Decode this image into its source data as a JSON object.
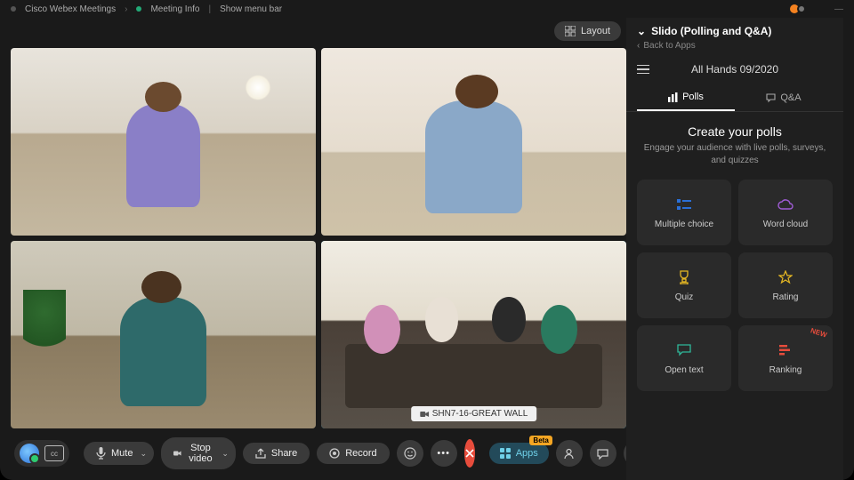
{
  "titlebar": {
    "app_name": "Cisco Webex Meetings",
    "menu1": "Meeting Info",
    "menu2": "Show menu bar"
  },
  "layout": {
    "label": "Layout"
  },
  "tiles": {
    "room_label": "SHN7-16-GREAT WALL"
  },
  "controls": {
    "mute": "Mute",
    "stop_video": "Stop video",
    "share": "Share",
    "record": "Record",
    "apps": "Apps",
    "apps_badge": "Beta"
  },
  "panel": {
    "title": "Slido (Polling and Q&A)",
    "back": "Back to Apps",
    "event": "All Hands 09/2020",
    "tabs": {
      "polls": "Polls",
      "qa": "Q&A"
    },
    "create": {
      "heading": "Create your polls",
      "sub": "Engage your audience with live polls, surveys, and quizzes"
    },
    "cards": {
      "multiple_choice": "Multiple choice",
      "word_cloud": "Word cloud",
      "quiz": "Quiz",
      "rating": "Rating",
      "open_text": "Open text",
      "ranking": "Ranking",
      "new": "NEW"
    }
  }
}
